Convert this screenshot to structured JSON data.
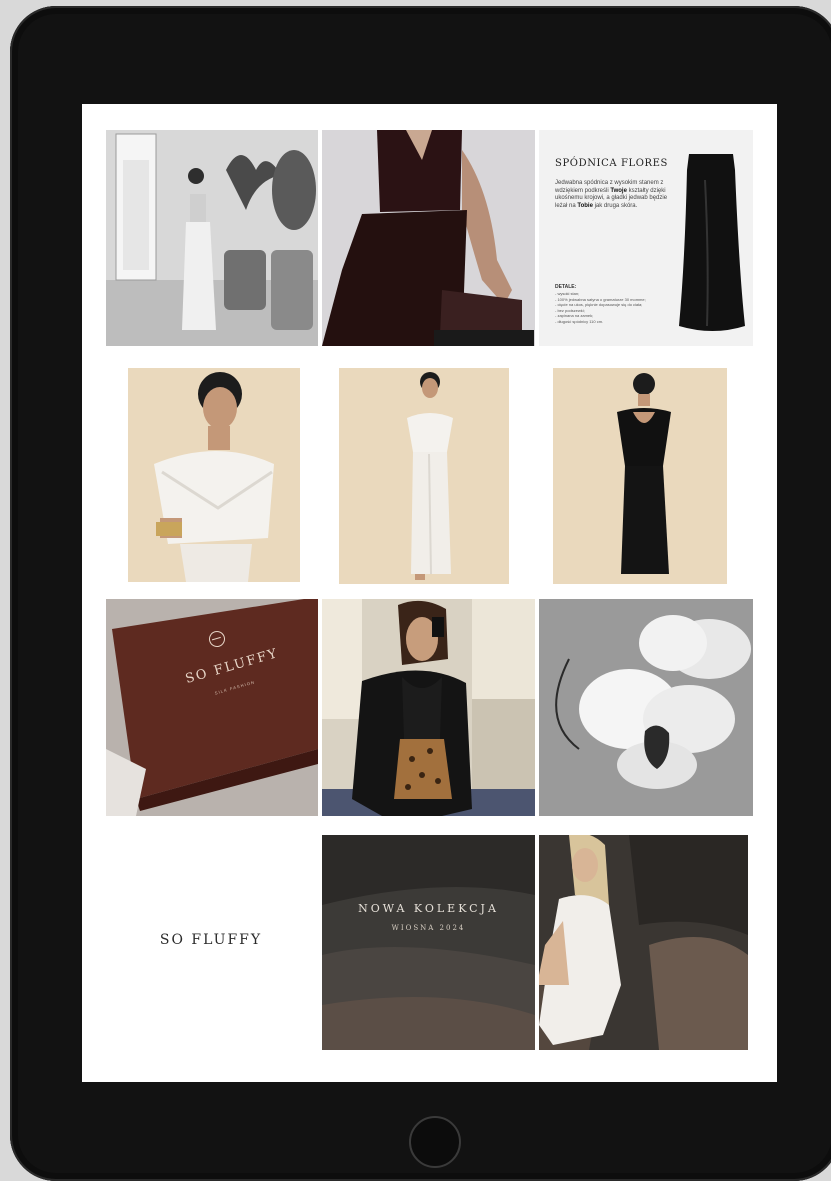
{
  "colors": {
    "device": "#121212",
    "screen": "#ffffff",
    "cream_background": "#ead9bd",
    "burgundy": "#5e2a20",
    "dark_satin": "#2b1214"
  },
  "icons": {
    "brand_logo": "circle-with-bar-icon",
    "home_button": "home-button-icon"
  },
  "product": {
    "title": "SPÓDNICA FLORES",
    "description_1": "Jedwabna spódnica z wysokim stanem z wdziękiem podkreśli ",
    "description_bold_1": "Twoje",
    "description_2": " kształty dzięki ukośnemu krojowi, a gładki jedwab będzie leżał na ",
    "description_bold_2": "Tobie",
    "description_3": " jak druga skóra.",
    "details_title": "DETALE:",
    "details": [
      "- wysoki stan;",
      "- 100% jedwabna satyna o gramaturze 30 momme;",
      "- cięcie na ukos, pięknie dopasowuje się do ciała;",
      "- bez podszewki;",
      "- zapinana na zamek;",
      "- długość spódnicy 110 cm."
    ]
  },
  "box": {
    "brand": "SO FLUFFY",
    "subtitle": "SILK FASHION"
  },
  "brand_text": "SO FLUFFY",
  "collection": {
    "title": "NOWA KOLEKCJA",
    "subtitle": "WIOSNA 2024"
  }
}
